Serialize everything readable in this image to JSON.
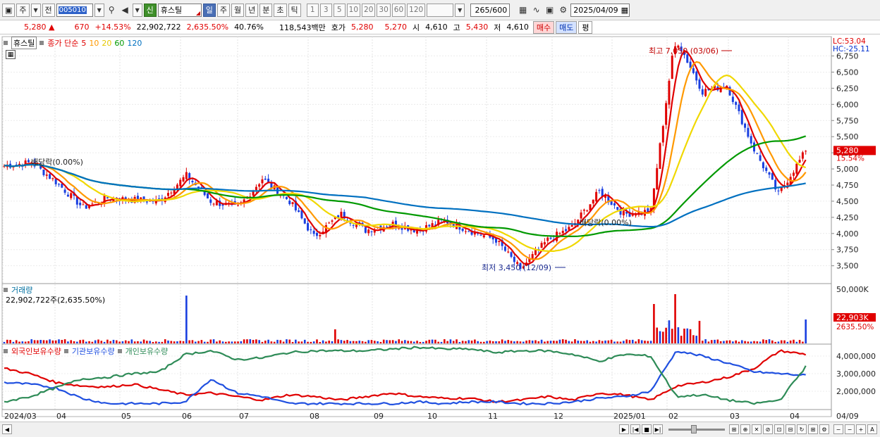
{
  "toolbar": {
    "type_label": "주",
    "prev_label": "전",
    "code": "005010",
    "stock_name": "휴스틸",
    "credit_badge": "신",
    "periods": [
      "일",
      "주",
      "월",
      "년",
      "분",
      "초",
      "틱"
    ],
    "active_period": "일",
    "minute_steps": [
      "1",
      "3",
      "5",
      "10",
      "20",
      "30",
      "60",
      "120"
    ],
    "count": "265",
    "count_total": "/600",
    "date": "2025/04/09"
  },
  "quote": {
    "price": "5,280",
    "change": "670",
    "change_pct": "+14.53%",
    "volume": "22,902,722",
    "volume_ratio": "2,635.50%",
    "turnover": "40.76%",
    "amount": "118,543백만",
    "ask_label": "호가",
    "ask_price": "5,280",
    "bid_price": "5,270",
    "open_label": "시",
    "open": "4,610",
    "high_label": "고",
    "high": "5,430",
    "low_label": "저",
    "low": "4,610",
    "buy_label": "매수",
    "sell_label": "매도",
    "eval_label": "평"
  },
  "price_legend": {
    "stock_name": "휴스틸",
    "ma_title": "종가 단순",
    "ma": [
      {
        "period": "5",
        "color": "#e00000"
      },
      {
        "period": "10",
        "color": "#ff9900"
      },
      {
        "period": "20",
        "color": "#f0d800"
      },
      {
        "period": "60",
        "color": "#009900"
      },
      {
        "period": "120",
        "color": "#0070c0"
      }
    ],
    "lc": "LC:53.04",
    "hc": "HC:-25.11"
  },
  "annotations": {
    "high": "최고 7,050 (03/06)",
    "low": "최저 3,450 (12/09)",
    "dividend1": "배당락(0.00%)",
    "dividend2": "배당락(0.00%)"
  },
  "price_axis": {
    "ticks": [
      "6,750",
      "6,500",
      "6,250",
      "6,000",
      "5,750",
      "5,500",
      "5,250",
      "5,000",
      "4,750",
      "4,500",
      "4,250",
      "4,000",
      "3,750",
      "3,500"
    ],
    "current_tag": "5,280",
    "current_pct": "15.54%"
  },
  "volume_panel": {
    "title": "거래량",
    "value": "22,902,722주(2,635.50%)",
    "axis_max": "50,000K",
    "current_tag": "22,903K",
    "current_pct": "2635.50%"
  },
  "holdings_panel": {
    "series": [
      {
        "name": "외국인보유수량",
        "color": "#e00000"
      },
      {
        "name": "기관보유수량",
        "color": "#2050e0"
      },
      {
        "name": "개인보유수량",
        "color": "#2e8b57"
      }
    ],
    "ticks": [
      "4,000,000",
      "3,000,000",
      "2,000,000"
    ]
  },
  "x_axis": {
    "labels": [
      "2024/03",
      "04",
      "05",
      "06",
      "07",
      "08",
      "09",
      "10",
      "11",
      "12",
      "2025/01",
      "02",
      "03",
      "04"
    ],
    "end_label": "04/09"
  },
  "chart_data": {
    "type": "candlestick",
    "title": "휴스틸",
    "x_range": [
      "2024/03",
      "2025/04/09"
    ],
    "ylim": [
      3300,
      7050
    ],
    "price_path": [
      {
        "date": "2024/03",
        "close": 5050
      },
      {
        "date": "2024/03 mid",
        "close": 5100
      },
      {
        "date": "2024/04",
        "close": 4800
      },
      {
        "date": "2024/04 mid",
        "close": 4400
      },
      {
        "date": "2024/05",
        "close": 4550
      },
      {
        "date": "2024/05 mid",
        "close": 4520
      },
      {
        "date": "2024/06",
        "close": 4500
      },
      {
        "date": "2024/06 mid",
        "close": 4900
      },
      {
        "date": "2024/07",
        "close": 4500
      },
      {
        "date": "2024/07 mid",
        "close": 4400
      },
      {
        "date": "2024/07 end",
        "close": 4850
      },
      {
        "date": "2024/08",
        "close": 4500
      },
      {
        "date": "2024/08 mid",
        "close": 3950
      },
      {
        "date": "2024/09",
        "close": 4300
      },
      {
        "date": "2024/09 mid",
        "close": 4050
      },
      {
        "date": "2024/10",
        "close": 4150
      },
      {
        "date": "2024/10 mid",
        "close": 4050
      },
      {
        "date": "2024/11",
        "close": 4200
      },
      {
        "date": "2024/11 mid",
        "close": 4050
      },
      {
        "date": "2024/12",
        "close": 3900
      },
      {
        "date": "2024/12/09",
        "close": 3450
      },
      {
        "date": "2024/12 end",
        "close": 3900
      },
      {
        "date": "2025/01",
        "close": 4100
      },
      {
        "date": "2025/01 mid",
        "close": 4650
      },
      {
        "date": "2025/02",
        "close": 4300
      },
      {
        "date": "2025/02 mid",
        "close": 4350
      },
      {
        "date": "2025/03/06",
        "close": 7050
      },
      {
        "date": "2025/03 mid",
        "close": 6200
      },
      {
        "date": "2025/03 end",
        "close": 6300
      },
      {
        "date": "2025/04",
        "close": 5300
      },
      {
        "date": "2025/04/08",
        "close": 4610
      },
      {
        "date": "2025/04/09",
        "close": 5280
      }
    ],
    "annotations": [
      {
        "label": "최고 7,050 (03/06)",
        "date": "2025/03/06",
        "value": 7050
      },
      {
        "label": "최저 3,450 (12/09)",
        "date": "2024/12/09",
        "value": 3450
      }
    ]
  }
}
